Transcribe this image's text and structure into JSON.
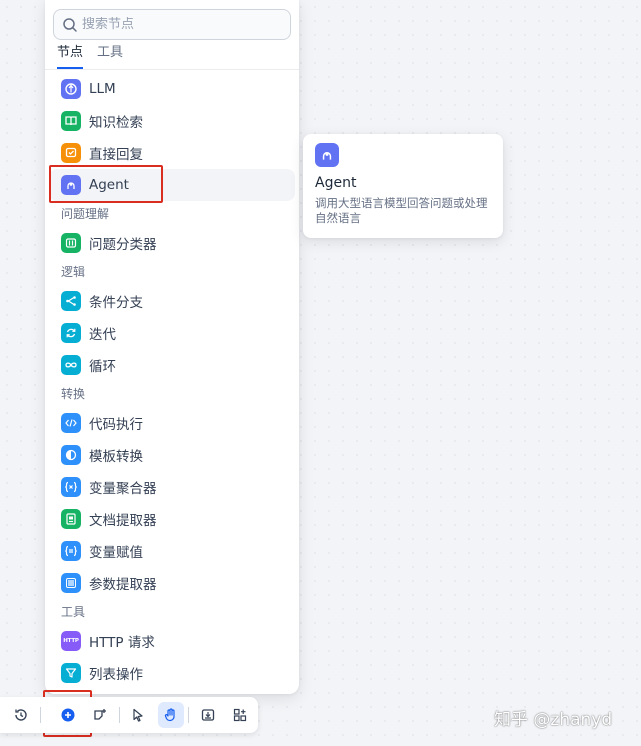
{
  "search": {
    "placeholder": "搜索节点"
  },
  "tabs": [
    {
      "label": "节点",
      "active": true
    },
    {
      "label": "工具",
      "active": false
    }
  ],
  "nodes": {
    "top": [
      {
        "label": "LLM",
        "icon": "llm-icon",
        "color": "#6172f3"
      },
      {
        "label": "知识检索",
        "icon": "knowledge-retrieval-icon",
        "color": "#16b364"
      },
      {
        "label": "直接回复",
        "icon": "direct-reply-icon",
        "color": "#f79009"
      },
      {
        "label": "Agent",
        "icon": "agent-icon",
        "color": "#6172f3"
      }
    ],
    "section_understanding": "问题理解",
    "understanding": [
      {
        "label": "问题分类器",
        "icon": "question-classifier-icon",
        "color": "#16b364"
      }
    ],
    "section_logic": "逻辑",
    "logic": [
      {
        "label": "条件分支",
        "icon": "if-else-icon",
        "color": "#06aed4"
      },
      {
        "label": "迭代",
        "icon": "iteration-icon",
        "color": "#06aed4"
      },
      {
        "label": "循环",
        "icon": "loop-icon",
        "color": "#06aed4"
      }
    ],
    "section_transform": "转换",
    "transform": [
      {
        "label": "代码执行",
        "icon": "code-icon",
        "color": "#2e90fa"
      },
      {
        "label": "模板转换",
        "icon": "template-icon",
        "color": "#2e90fa"
      },
      {
        "label": "变量聚合器",
        "icon": "variable-aggregator-icon",
        "color": "#2e90fa"
      },
      {
        "label": "文档提取器",
        "icon": "doc-extractor-icon",
        "color": "#16b364"
      },
      {
        "label": "变量赋值",
        "icon": "variable-assign-icon",
        "color": "#2e90fa"
      },
      {
        "label": "参数提取器",
        "icon": "parameter-extractor-icon",
        "color": "#2e90fa"
      }
    ],
    "section_tools": "工具",
    "tools": [
      {
        "label": "HTTP 请求",
        "icon": "http-icon",
        "color": "#875bf7",
        "badge": "HTTP"
      },
      {
        "label": "列表操作",
        "icon": "list-filter-icon",
        "color": "#06aed4"
      }
    ]
  },
  "tooltip": {
    "title": "Agent",
    "description": "调用大型语言模型回答问题或处理自然语言",
    "icon": "agent-icon",
    "color": "#6172f3"
  },
  "toolbar": {
    "buttons": [
      "history-icon",
      "add-node-icon",
      "add-note-icon",
      "pointer-icon",
      "hand-icon",
      "export-icon",
      "organize-icon"
    ],
    "active": "hand-icon",
    "accent": "#155eef"
  },
  "watermark": "知乎 @zhanyd"
}
